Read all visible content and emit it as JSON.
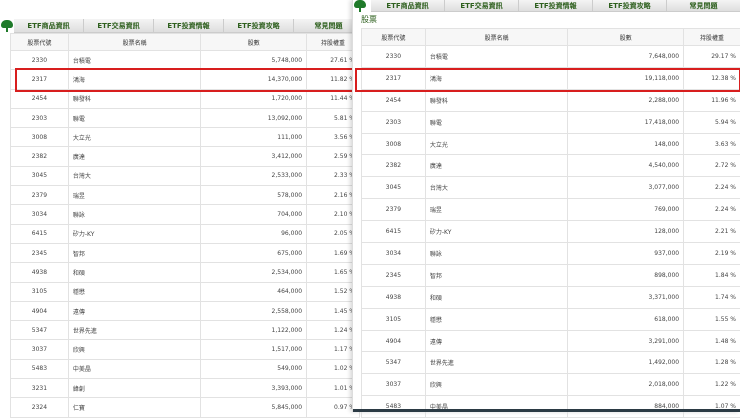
{
  "nav_tabs": [
    "ETF商品資訊",
    "ETF交易資訊",
    "ETF投資情報",
    "ETF投資攻略",
    "常見問題"
  ],
  "section_title": "股票",
  "columns": [
    "股票代號",
    "股票名稱",
    "股數",
    "持股權重"
  ],
  "left_table": [
    [
      "2330",
      "台積電",
      "5,748,000",
      "27.61 %"
    ],
    [
      "2317",
      "鴻海",
      "14,370,000",
      "11.82 %"
    ],
    [
      "2454",
      "聯發科",
      "1,720,000",
      "11.44 %"
    ],
    [
      "2303",
      "聯電",
      "13,092,000",
      "5.81 %"
    ],
    [
      "3008",
      "大立光",
      "111,000",
      "3.56 %"
    ],
    [
      "2382",
      "廣達",
      "3,412,000",
      "2.59 %"
    ],
    [
      "3045",
      "台灣大",
      "2,533,000",
      "2.33 %"
    ],
    [
      "2379",
      "瑞昱",
      "578,000",
      "2.16 %"
    ],
    [
      "3034",
      "聯詠",
      "704,000",
      "2.10 %"
    ],
    [
      "6415",
      "矽力-KY",
      "96,000",
      "2.05 %"
    ],
    [
      "2345",
      "智邦",
      "675,000",
      "1.69 %"
    ],
    [
      "4938",
      "和碩",
      "2,534,000",
      "1.65 %"
    ],
    [
      "3105",
      "穩懋",
      "464,000",
      "1.52 %"
    ],
    [
      "4904",
      "遠傳",
      "2,558,000",
      "1.45 %"
    ],
    [
      "5347",
      "世界先進",
      "1,122,000",
      "1.24 %"
    ],
    [
      "3037",
      "欣興",
      "1,517,000",
      "1.17 %"
    ],
    [
      "5483",
      "中美晶",
      "549,000",
      "1.02 %"
    ],
    [
      "3231",
      "緯創",
      "3,393,000",
      "1.01 %"
    ],
    [
      "2324",
      "仁寶",
      "5,845,000",
      "0.97 %"
    ]
  ],
  "right_table": [
    [
      "2330",
      "台積電",
      "7,648,000",
      "29.17 %"
    ],
    [
      "2317",
      "鴻海",
      "19,118,000",
      "12.38 %"
    ],
    [
      "2454",
      "聯發科",
      "2,288,000",
      "11.96 %"
    ],
    [
      "2303",
      "聯電",
      "17,418,000",
      "5.94 %"
    ],
    [
      "3008",
      "大立光",
      "148,000",
      "3.63 %"
    ],
    [
      "2382",
      "廣達",
      "4,540,000",
      "2.72 %"
    ],
    [
      "3045",
      "台灣大",
      "3,077,000",
      "2.24 %"
    ],
    [
      "2379",
      "瑞昱",
      "769,000",
      "2.24 %"
    ],
    [
      "6415",
      "矽力-KY",
      "128,000",
      "2.21 %"
    ],
    [
      "3034",
      "聯詠",
      "937,000",
      "2.19 %"
    ],
    [
      "2345",
      "智邦",
      "898,000",
      "1.84 %"
    ],
    [
      "4938",
      "和碩",
      "3,371,000",
      "1.74 %"
    ],
    [
      "3105",
      "穩懋",
      "618,000",
      "1.55 %"
    ],
    [
      "4904",
      "遠傳",
      "3,291,000",
      "1.48 %"
    ],
    [
      "5347",
      "世界先進",
      "1,492,000",
      "1.28 %"
    ],
    [
      "3037",
      "欣興",
      "2,018,000",
      "1.22 %"
    ],
    [
      "5483",
      "中美晶",
      "884,000",
      "1.07 %"
    ]
  ],
  "highlight_color": "#d81e1e"
}
